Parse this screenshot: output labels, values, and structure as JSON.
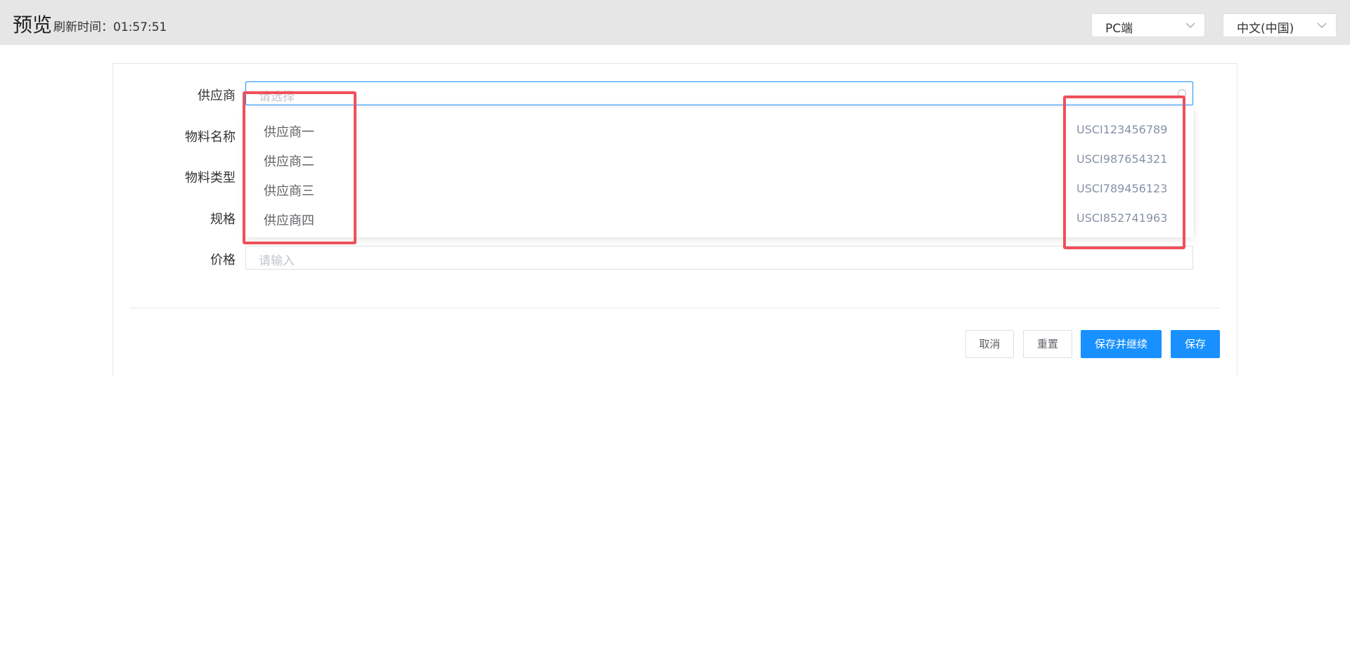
{
  "header": {
    "title": "预览",
    "refresh": "刷新时间：01:57:51",
    "platform_select": "PC端",
    "language_select": "中文(中国)"
  },
  "form": {
    "fields": [
      {
        "label": "供应商",
        "placeholder": "请选择"
      },
      {
        "label": "物料名称"
      },
      {
        "label": "物料类型"
      },
      {
        "label": "规格"
      },
      {
        "label": "价格",
        "placeholder": "请输入"
      }
    ]
  },
  "dropdown": {
    "options": [
      {
        "name": "供应商一",
        "code": "USCI123456789"
      },
      {
        "name": "供应商二",
        "code": "USCI987654321"
      },
      {
        "name": "供应商三",
        "code": "USCI789456123"
      },
      {
        "name": "供应商四",
        "code": "USCI852741963"
      }
    ]
  },
  "buttons": {
    "cancel": "取消",
    "reset": "重置",
    "save_continue": "保存并继续",
    "save": "保存"
  },
  "colors": {
    "primary": "#1890ff",
    "highlight": "#f0505a",
    "topbar": "#e6e6e6"
  }
}
